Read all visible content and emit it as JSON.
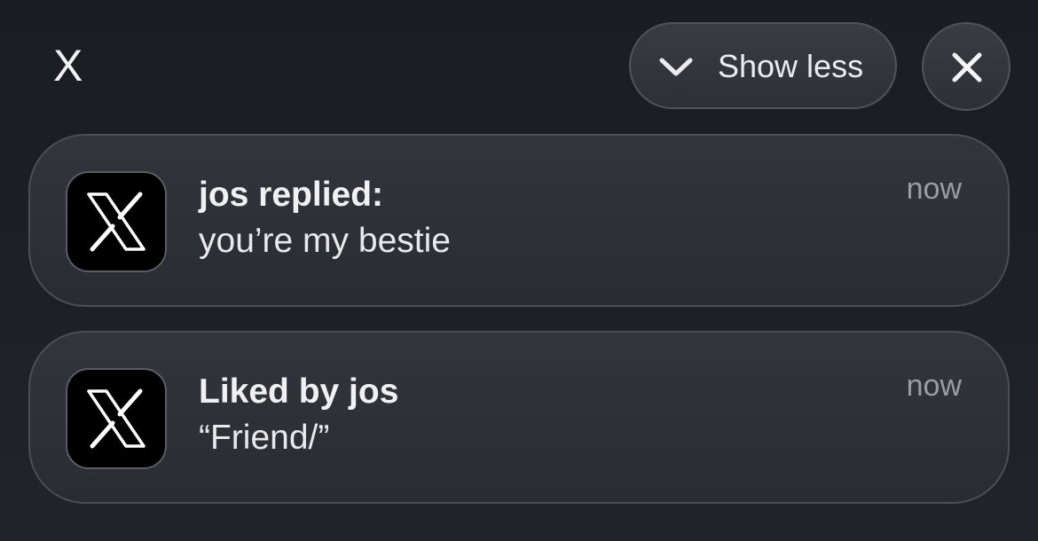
{
  "group": {
    "title": "X",
    "show_less_label": "Show less",
    "show_less_icon": "chevron-down-icon",
    "close_icon": "close-icon"
  },
  "notifications": [
    {
      "app_icon": "x-logo-icon",
      "title": "jos replied:",
      "body": "you’re my bestie",
      "time": "now"
    },
    {
      "app_icon": "x-logo-icon",
      "title": "Liked by jos",
      "body": "“Friend/”",
      "time": "now"
    }
  ],
  "colors": {
    "background": "#1b1d24",
    "card": "#2f3138",
    "text_primary": "#f1f1f3",
    "text_secondary": "#9a9ca3"
  }
}
